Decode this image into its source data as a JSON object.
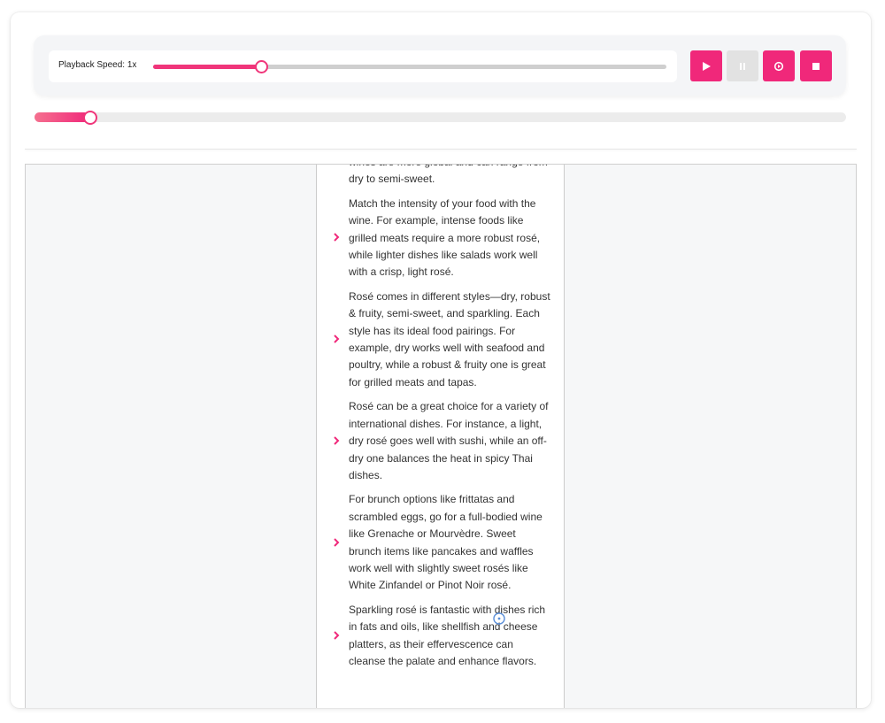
{
  "playback": {
    "speed_label": "Playback Speed: 1x",
    "speed_fraction": 0.21,
    "progress_fraction": 0.068
  },
  "controls": {
    "play": "play-icon",
    "pause": "pause-icon",
    "record": "record-icon",
    "stop": "stop-icon",
    "accent_color": "#f0287a",
    "disabled_color": "#e2e2e2"
  },
  "content": {
    "items": [
      {
        "text": "wines are more global and can range from dry to semi-sweet."
      },
      {
        "text": "Match the intensity of your food with the wine. For example, intense foods like grilled meats require a more robust rosé, while lighter dishes like salads work well with a crisp, light rosé."
      },
      {
        "text": "Rosé comes in different styles—dry, robust & fruity, semi-sweet, and sparkling. Each style has its ideal food pairings. For example, dry works well with seafood and poultry, while a robust & fruity one is great for grilled meats and tapas."
      },
      {
        "text": "Rosé can be a great choice for a variety of international dishes. For instance, a light, dry rosé goes well with sushi, while an off-dry one balances the heat in spicy Thai dishes."
      },
      {
        "text": "For brunch options like frittatas and scrambled eggs, go for a full-bodied wine like Grenache or Mourvèdre. Sweet brunch items like pancakes and waffles work well with slightly sweet rosés like White Zinfandel or Pinot Noir rosé."
      },
      {
        "text": "Sparkling rosé is fantastic with dishes rich in fats and oils, like shellfish and cheese platters, as their effervescence can cleanse the palate and enhance flavors."
      }
    ]
  }
}
